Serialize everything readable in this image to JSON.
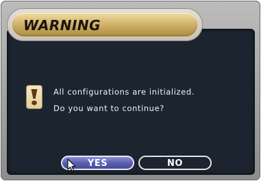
{
  "dialog": {
    "title": "WARNING",
    "message_line1": "All configurations are initialized.",
    "message_line2": "Do you want to continue?",
    "icon": "exclamation-icon"
  },
  "buttons": {
    "yes_label": "YES",
    "no_label": "NO",
    "selected": "YES"
  },
  "colors": {
    "title_gold": "#d2b56c",
    "panel_bg": "#1c2430",
    "selected_button": "#5a5fb0",
    "frame_gray": "#9c9c9c"
  }
}
